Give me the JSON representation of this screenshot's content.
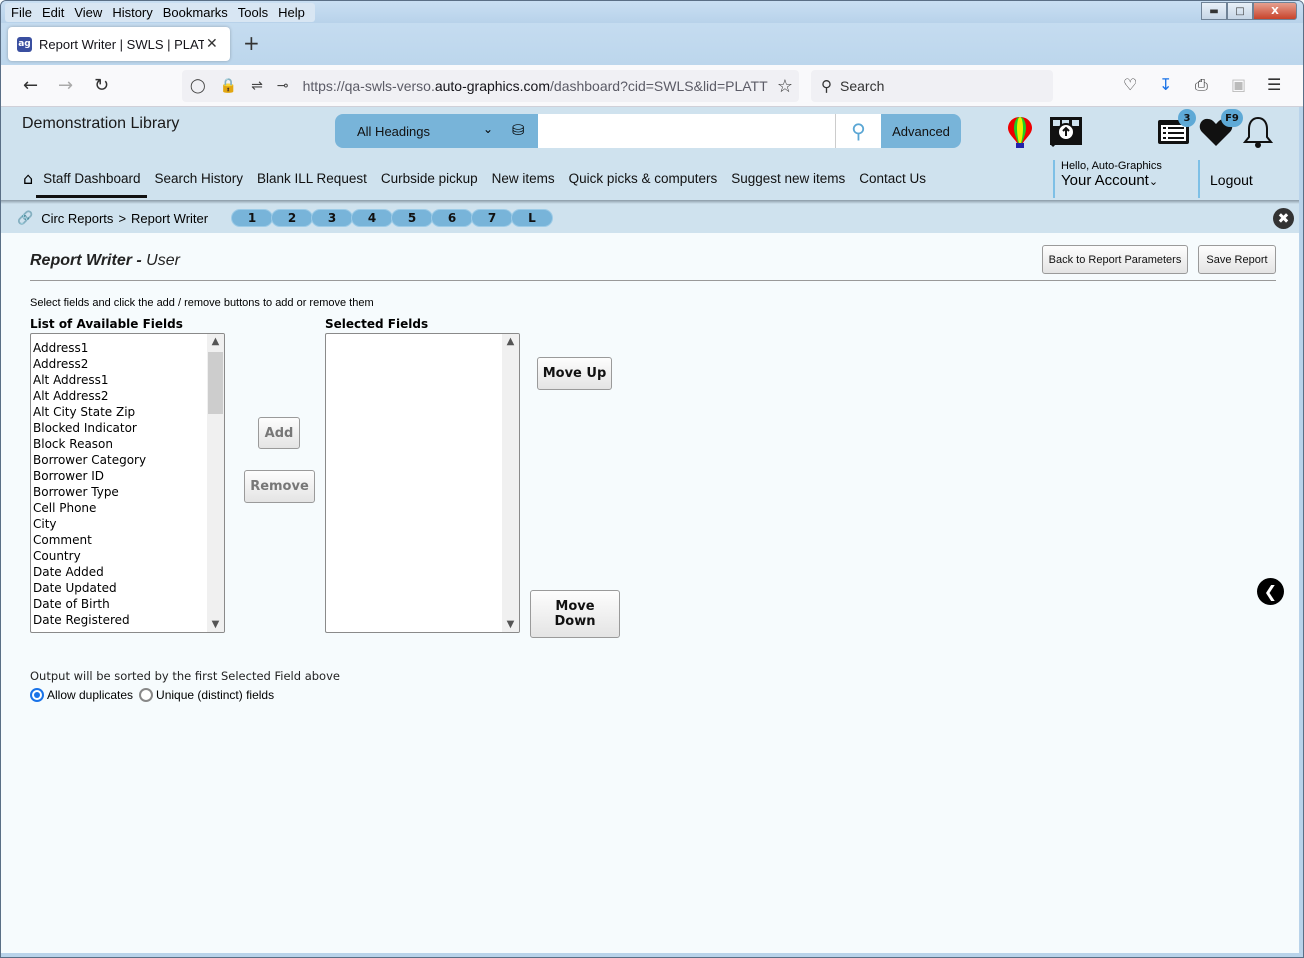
{
  "browser": {
    "menu": [
      "File",
      "Edit",
      "View",
      "History",
      "Bookmarks",
      "Tools",
      "Help"
    ],
    "tab_title": "Report Writer | SWLS | PLATT | Auto-Graphics",
    "favicon": "ag",
    "new_tab": "+",
    "url_prefix": "https://qa-swls-verso.",
    "url_domain": "auto-graphics.com",
    "url_suffix": "/dashboard?cid=SWLS&lid=PLATT",
    "search_placeholder": "Search"
  },
  "header": {
    "library_name": "Demonstration Library",
    "search_scope": "All Headings",
    "search_value": "",
    "advanced_label": "Advanced",
    "list_badge": "3",
    "favorites_badge": "F9",
    "nav": [
      "Staff Dashboard",
      "Search History",
      "Blank ILL Request",
      "Curbside pickup",
      "New items",
      "Quick picks & computers",
      "Suggest new items",
      "Contact Us"
    ],
    "greeting": "Hello, Auto-Graphics",
    "account_label": "Your Account",
    "logout_label": "Logout"
  },
  "breadcrumb": {
    "parent": "Circ Reports",
    "separator": ">",
    "current": "Report Writer",
    "steps": [
      "1",
      "2",
      "3",
      "4",
      "5",
      "6",
      "7",
      "L"
    ]
  },
  "page": {
    "title_main": "Report Writer - ",
    "title_sub": "User",
    "back_button": "Back to Report Parameters",
    "save_button": "Save Report",
    "instructions": "Select fields and click the add / remove buttons to add or remove them",
    "available_label": "List of Available Fields",
    "selected_label": "Selected Fields",
    "available_fields": [
      "Address1",
      "Address2",
      "Alt Address1",
      "Alt Address2",
      "Alt City State Zip",
      "Blocked Indicator",
      "Block Reason",
      "Borrower Category",
      "Borrower ID",
      "Borrower Type",
      "Cell Phone",
      "City",
      "Comment",
      "Country",
      "Date Added",
      "Date Updated",
      "Date of Birth",
      "Date Registered"
    ],
    "selected_fields": [],
    "add_button": "Add",
    "remove_button": "Remove",
    "move_up_button": "Move Up",
    "move_down_button": "Move Down",
    "sort_note": "Output will be sorted by the first Selected Field above",
    "radio_allow": "Allow duplicates",
    "radio_unique": "Unique (distinct) fields",
    "radio_selected": "allow"
  }
}
